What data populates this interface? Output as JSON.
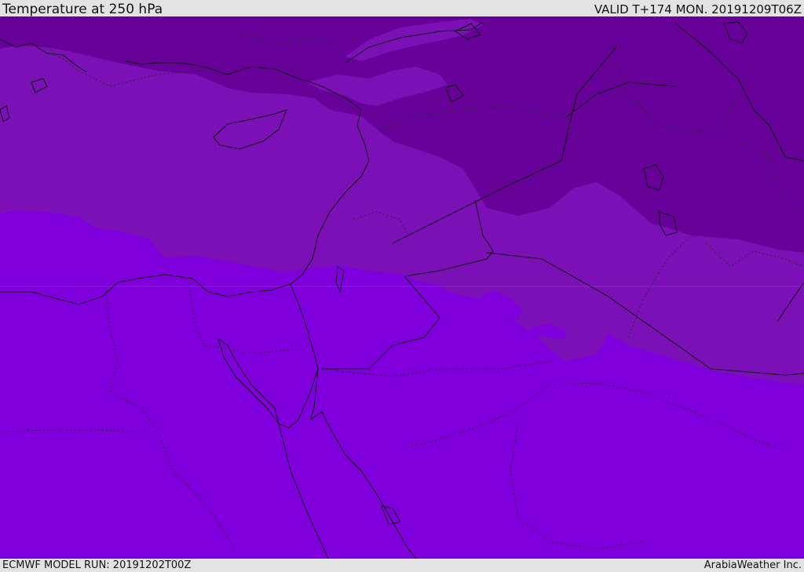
{
  "header": {
    "title": "Temperature at 250 hPa",
    "valid": "VALID T+174 MON. 20191209T06Z"
  },
  "footer": {
    "model_run": "ECMWF MODEL RUN: 20191202T00Z",
    "credit": "ArabiaWeather Inc."
  },
  "map": {
    "field": "temperature",
    "level": "250 hPa",
    "fill_colors": {
      "coldest": "#68009a",
      "cold": "#7a10b5",
      "warm": "#7f00dc"
    },
    "line_colors": {
      "coastline": "#111111",
      "border": "#222222"
    }
  }
}
